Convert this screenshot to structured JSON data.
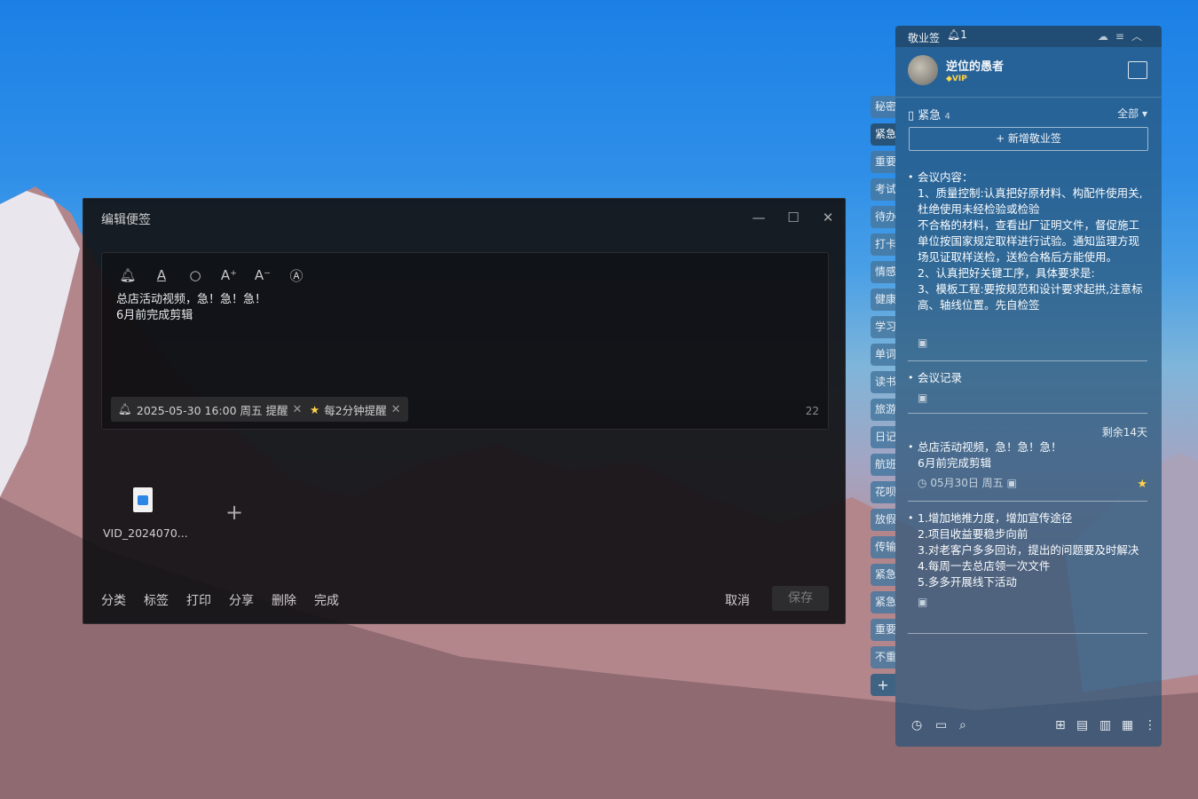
{
  "editor": {
    "title": "编辑便签",
    "window_controls": [
      "minimize-icon",
      "maximize-icon",
      "close-icon"
    ],
    "toolbar_icons": [
      "bell-icon",
      "text-color-icon",
      "search-icon",
      "font-increase-icon",
      "font-decrease-icon",
      "ocr-icon"
    ],
    "text_line1": "总店活动视频，急！急！急！",
    "text_line2": "6月前完成剪辑",
    "reminder_chip": "2025-05-30 16:00 周五 提醒",
    "repeat_chip": "每2分钟提醒",
    "char_count": "22",
    "attachment_name": "VID_2024070...",
    "bottom_links": [
      "分类",
      "标签",
      "打印",
      "分享",
      "删除",
      "完成"
    ],
    "cancel_label": "取消",
    "save_label": "保存"
  },
  "side_tabs": [
    "秘密",
    "紧急",
    "重要",
    "考试",
    "待办",
    "打卡",
    "情感",
    "健康",
    "学习",
    "单词",
    "读书",
    "旅游",
    "日记",
    "航班",
    "花呗",
    "放假",
    "传输",
    "紧急",
    "紧急",
    "重要",
    "不重"
  ],
  "side_tabs_add": "+",
  "panel": {
    "app_name": "敬业签",
    "notification_count": "1",
    "header_icons": [
      "cloud-icon",
      "menu-icon",
      "collapse-icon"
    ],
    "username": "逆位的愚者",
    "vip_label": "VIP",
    "category_name": "紧急",
    "category_count": "4",
    "filter_label": "全部",
    "new_note_label": "+ 新增敬业签",
    "notes": [
      {
        "text": "会议内容：\n1、质量控制:认真把好原材料、构配件使用关,杜绝使用未经检验或检验\n不合格的材料，查看出厂证明文件，督促施工单位按国家规定取样进行试验。通知监理方现场见证取样送检，送检合格后方能使用。\n2、认真把好关键工序，具体要求是:\n3、模板工程:要按规范和设计要求起拱,注意标高、轴线位置。先自检签"
      },
      {
        "text": "会议记录"
      },
      {
        "text": "总店活动视频，急！急！急！\n6月前完成剪辑",
        "remaining": "剩余14天",
        "date": "05月30日 周五"
      },
      {
        "text": "1.增加地推力度，增加宣传途径\n2.项目收益要稳步向前\n3.对老客户多多回访，提出的问题要及时解决\n4.每周一去总店领一次文件\n5.多多开展线下活动"
      }
    ],
    "footer_icons": [
      "clock-icon",
      "archive-icon",
      "search-icon",
      "add-icon",
      "account-icon",
      "print-icon",
      "calculator-icon",
      "more-icon"
    ]
  },
  "colors": {
    "editor_bg": "#121214",
    "panel_bg": "#285578",
    "accent_yellow": "#ffd34a"
  }
}
